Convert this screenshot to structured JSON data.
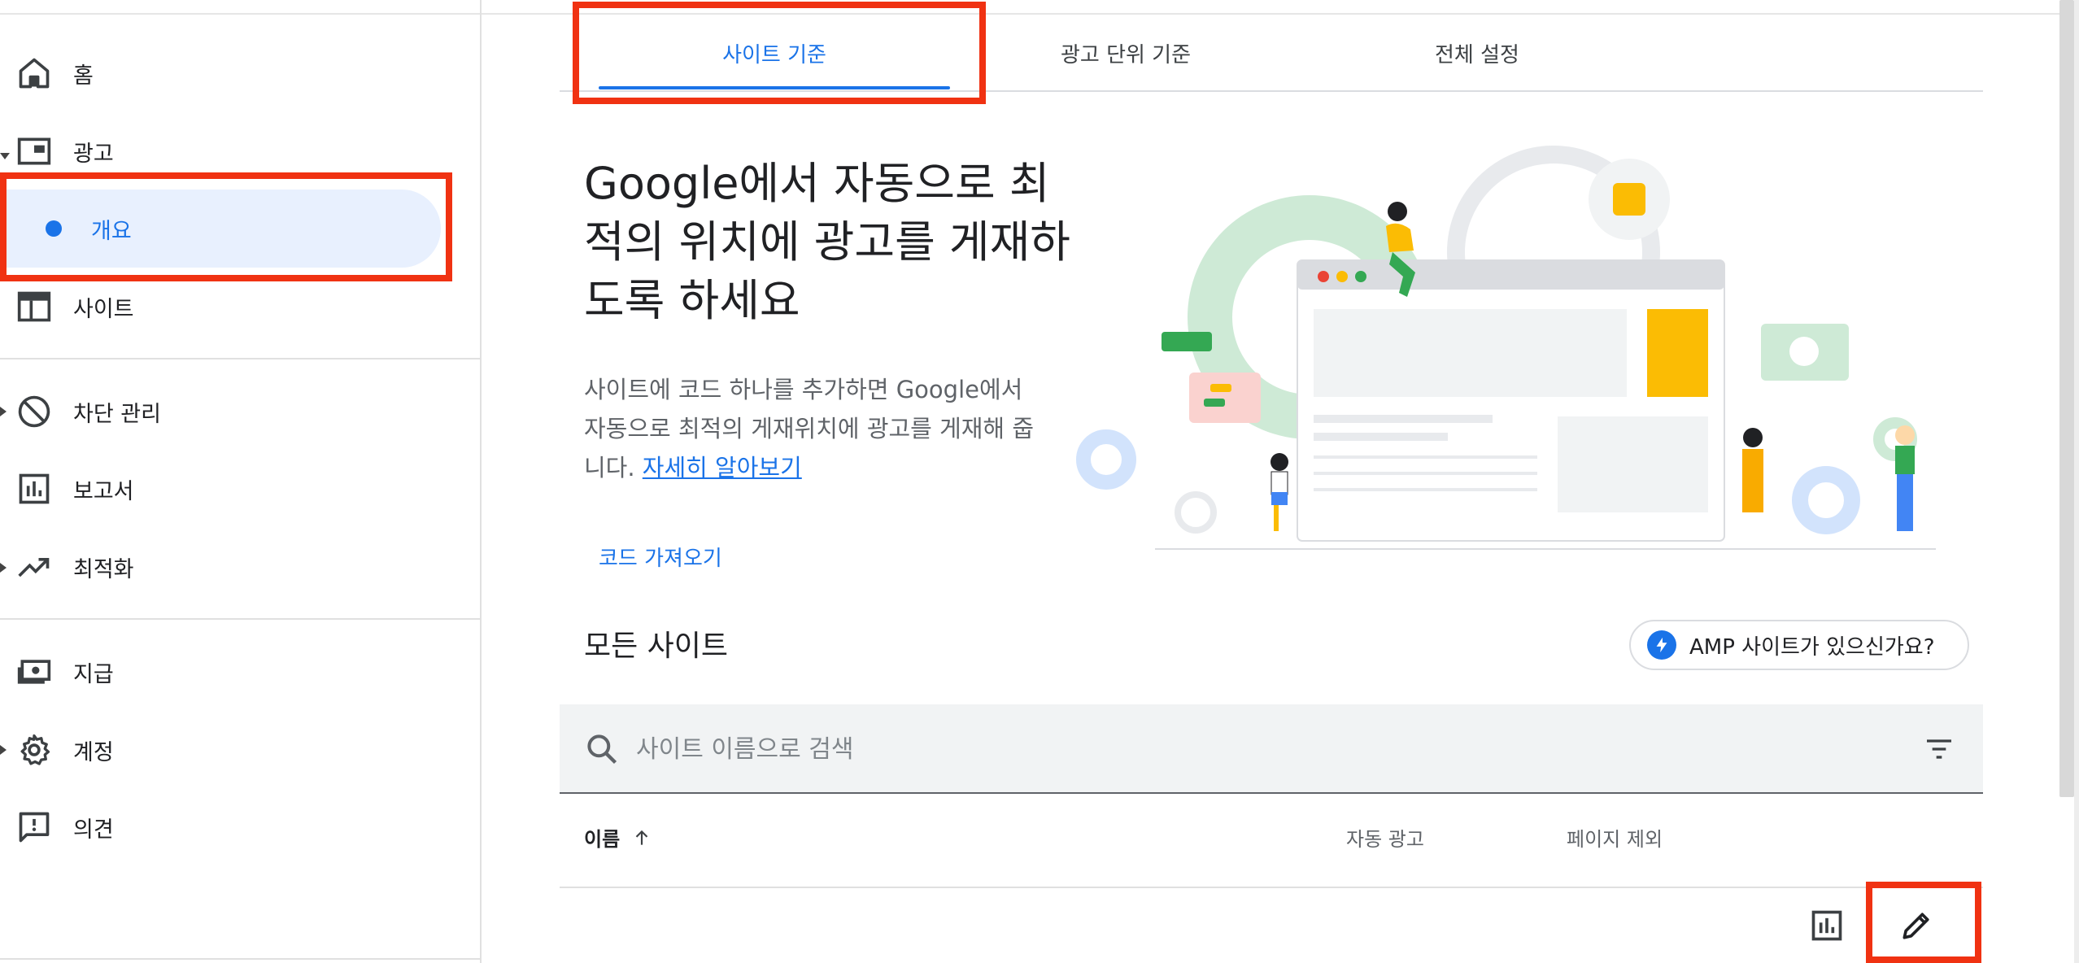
{
  "sidebar": {
    "items": [
      {
        "label": "홈",
        "icon": "home-icon"
      },
      {
        "label": "광고",
        "icon": "ads-icon"
      },
      {
        "label": "개요",
        "icon": "dot-icon"
      },
      {
        "label": "사이트",
        "icon": "sites-icon"
      },
      {
        "label": "차단 관리",
        "icon": "block-icon"
      },
      {
        "label": "보고서",
        "icon": "reports-icon"
      },
      {
        "label": "최적화",
        "icon": "trending-up-icon"
      },
      {
        "label": "지급",
        "icon": "payments-icon"
      },
      {
        "label": "계정",
        "icon": "gear-icon"
      },
      {
        "label": "의견",
        "icon": "feedback-icon"
      }
    ]
  },
  "tabs": [
    {
      "label": "사이트 기준",
      "active": true
    },
    {
      "label": "광고 단위 기준",
      "active": false
    },
    {
      "label": "전체 설정",
      "active": false
    }
  ],
  "hero": {
    "title_lines": [
      "Google에서 자동으로 최",
      "적의 위치에 광고를 게재하",
      "도록 하세요"
    ],
    "desc_lines": [
      "사이트에 코드 하나를 추가하면 Google에서",
      "자동으로 최적의 게재위치에 광고를 게재해 줍",
      "니다. "
    ],
    "learn_more": "자세히 알아보기",
    "code_button": "코드 가져오기"
  },
  "all_sites": {
    "title": "모든 사이트",
    "amp_button": "AMP 사이트가 있으신가요?",
    "search_placeholder": "사이트 이름으로 검색",
    "columns": {
      "name": "이름",
      "auto_ads": "자동 광고",
      "page_exclusions": "페이지 제외"
    }
  },
  "colors": {
    "accent": "#1a73e8",
    "highlight": "#f03212",
    "active_bg": "#e8f0fe"
  }
}
